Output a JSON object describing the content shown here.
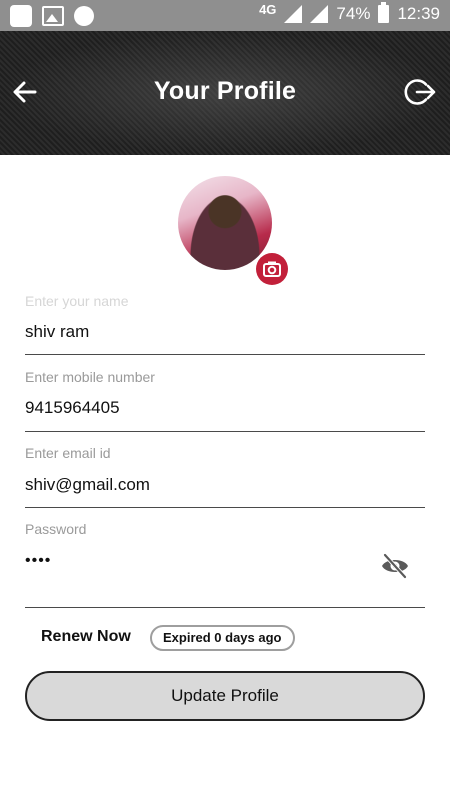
{
  "status_bar": {
    "network": "4G",
    "battery": "74%",
    "time": "12:39",
    "icons": [
      "notification-square-icon",
      "image-icon",
      "circle-icon",
      "signal-icon",
      "battery-icon"
    ]
  },
  "header": {
    "title": "Your Profile",
    "back_icon": "arrow-left-icon",
    "logout_icon": "logout-icon"
  },
  "profile": {
    "avatar_icon": "profile-photo",
    "camera_icon": "camera-icon"
  },
  "form": {
    "name": {
      "label": "Enter your name",
      "value": "shiv ram"
    },
    "mobile": {
      "label": "Enter mobile number",
      "value": "9415964405"
    },
    "email": {
      "label": "Enter email id",
      "value": "shiv@gmail.com"
    },
    "password": {
      "label": "Password",
      "value": "••••",
      "toggle_icon": "eye-off-icon"
    }
  },
  "subscription": {
    "renew_label": "Renew Now",
    "status": "Expired 0 days ago"
  },
  "actions": {
    "update_label": "Update Profile"
  },
  "colors": {
    "accent": "#c2203a",
    "status_bar": "#8f8f8f",
    "button_bg": "#d9d9d9"
  }
}
